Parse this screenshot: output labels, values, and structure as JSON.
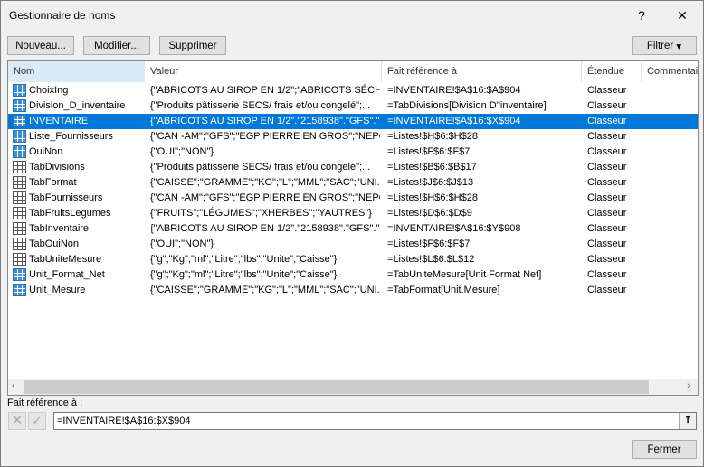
{
  "window": {
    "title": "Gestionnaire de noms",
    "help": "?",
    "close": "✕"
  },
  "toolbar": {
    "new": "Nouveau...",
    "edit": "Modifier...",
    "delete": "Supprimer",
    "filter": "Filtrer",
    "filter_arrow": "▾"
  },
  "columns": [
    "Nom",
    "Valeur",
    "Fait référence à",
    "Étendue",
    "Commentaire"
  ],
  "rows": [
    {
      "name": "ChoixIng",
      "value": "{\"ABRICOTS AU SIROP EN 1/2\";\"ABRICOTS SÉCH...",
      "ref": "=INVENTAIRE!$A$16:$A$904",
      "scope": "Classeur",
      "icon": "named"
    },
    {
      "name": "Division_D_inventaire",
      "value": "{\"Produits pâtisserie SECS/ frais et/ou congelé\";...",
      "ref": "=TabDivisions[Division D''inventaire]",
      "scope": "Classeur",
      "icon": "named"
    },
    {
      "name": "INVENTAIRE",
      "value": "{\"ABRICOTS AU SIROP EN 1/2\".\"2158938\".\"GFS\".\"...",
      "ref": "=INVENTAIRE!$A$16:$X$904",
      "scope": "Classeur",
      "icon": "named",
      "selected": true
    },
    {
      "name": "Liste_Fournisseurs",
      "value": "{\"CAN -AM\";\"GFS\";\"EGP PIERRE EN GROS\";\"NEPC...",
      "ref": "=Listes!$H$6:$H$28",
      "scope": "Classeur",
      "icon": "named"
    },
    {
      "name": "OuiNon",
      "value": "{\"OUI\";\"NON\"}",
      "ref": "=Listes!$F$6:$F$7",
      "scope": "Classeur",
      "icon": "named"
    },
    {
      "name": "TabDivisions",
      "value": "{\"Produits pâtisserie SECS/ frais et/ou congelé\";...",
      "ref": "=Listes!$B$6:$B$17",
      "scope": "Classeur",
      "icon": "table"
    },
    {
      "name": "TabFormat",
      "value": "{\"CAISSE\";\"GRAMME\";\"KG\";\"L\";\"MML\";\"SAC\";\"UNI...",
      "ref": "=Listes!$J$6:$J$13",
      "scope": "Classeur",
      "icon": "table"
    },
    {
      "name": "TabFournisseurs",
      "value": "{\"CAN -AM\";\"GFS\";\"EGP PIERRE EN GROS\";\"NEPC...",
      "ref": "=Listes!$H$6:$H$28",
      "scope": "Classeur",
      "icon": "table"
    },
    {
      "name": "TabFruitsLegumes",
      "value": "{\"FRUITS\";\"LÉGUMES\";\"XHERBES\";\"YAUTRES\"}",
      "ref": "=Listes!$D$6:$D$9",
      "scope": "Classeur",
      "icon": "table"
    },
    {
      "name": "TabInventaire",
      "value": "{\"ABRICOTS AU SIROP EN 1/2\".\"2158938\".\"GFS\".\"...",
      "ref": "=INVENTAIRE!$A$16:$Y$908",
      "scope": "Classeur",
      "icon": "table"
    },
    {
      "name": "TabOuiNon",
      "value": "{\"OUI\";\"NON\"}",
      "ref": "=Listes!$F$6:$F$7",
      "scope": "Classeur",
      "icon": "table"
    },
    {
      "name": "TabUniteMesure",
      "value": "{\"g\";\"Kg\";\"ml\";\"Litre\";\"lbs\";\"Unite\";\"Caisse\"}",
      "ref": "=Listes!$L$6:$L$12",
      "scope": "Classeur",
      "icon": "table"
    },
    {
      "name": "Unit_Format_Net",
      "value": "{\"g\";\"Kg\";\"ml\";\"Litre\";\"lbs\";\"Unite\";\"Caisse\"}",
      "ref": "=TabUniteMesure[Unit Format Net]",
      "scope": "Classeur",
      "icon": "named"
    },
    {
      "name": "Unit_Mesure",
      "value": "{\"CAISSE\";\"GRAMME\";\"KG\";\"L\";\"MML\";\"SAC\";\"UNI...",
      "ref": "=TabFormat[Unit.Mesure]",
      "scope": "Classeur",
      "icon": "named"
    }
  ],
  "refers_to": {
    "label": "Fait référence à :",
    "value": "=INVENTAIRE!$A$16:$X$904"
  },
  "footer": {
    "close": "Fermer"
  },
  "colors": {
    "selection": "#0078d7",
    "named_icon": "#3c8fd8"
  }
}
